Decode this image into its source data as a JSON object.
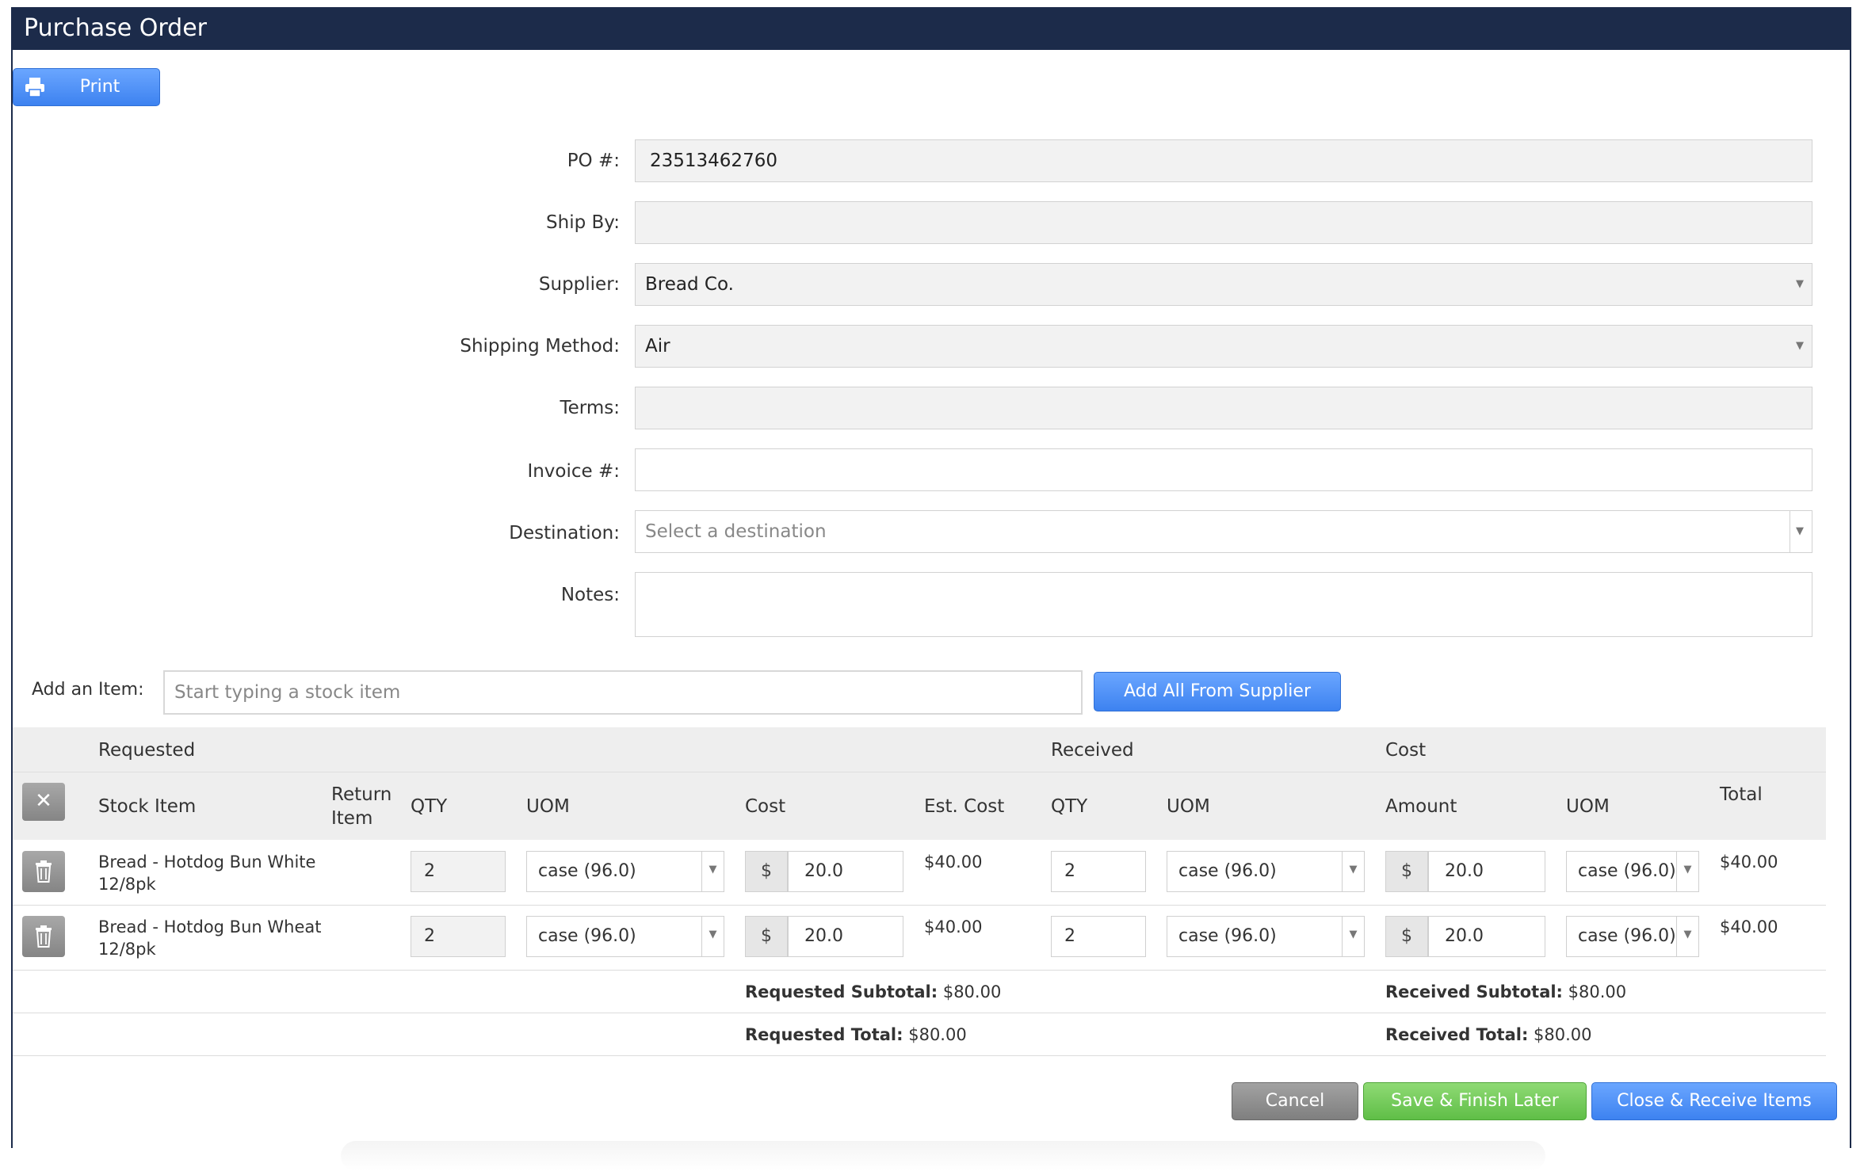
{
  "window": {
    "title": "Purchase Order"
  },
  "toolbar": {
    "print_label": "Print"
  },
  "form": {
    "po_label": "PO #:",
    "po_value": "23513462760",
    "ship_by_label": "Ship By:",
    "ship_by_value": "",
    "supplier_label": "Supplier:",
    "supplier_value": "Bread Co.",
    "shipping_method_label": "Shipping Method:",
    "shipping_method_value": "Air",
    "terms_label": "Terms:",
    "terms_value": "",
    "invoice_label": "Invoice #:",
    "invoice_value": "",
    "destination_label": "Destination:",
    "destination_placeholder": "Select a destination",
    "notes_label": "Notes:",
    "notes_value": ""
  },
  "add_item": {
    "label": "Add an Item:",
    "placeholder": "Start typing a stock item",
    "add_all_label": "Add All From Supplier"
  },
  "table": {
    "group_requested": "Requested",
    "group_received": "Received",
    "group_cost": "Cost",
    "col_stock_item": "Stock Item",
    "col_return_item": "Return Item",
    "col_req_qty": "QTY",
    "col_req_uom": "UOM",
    "col_req_cost": "Cost",
    "col_est_cost": "Est. Cost",
    "col_rec_qty": "QTY",
    "col_rec_uom": "UOM",
    "col_amount": "Amount",
    "col_cost_uom": "UOM",
    "col_total": "Total",
    "rows": [
      {
        "stock_item": "Bread - Hotdog Bun White 12/8pk",
        "req_qty": "2",
        "req_uom": "case (96.0)",
        "req_cost_symbol": "$",
        "req_cost": "20.0",
        "est_cost": "$40.00",
        "rec_qty": "2",
        "rec_uom": "case (96.0)",
        "amount_symbol": "$",
        "amount": "20.0",
        "cost_uom": "case (96.0)",
        "total": "$40.00"
      },
      {
        "stock_item": "Bread - Hotdog Bun Wheat 12/8pk",
        "req_qty": "2",
        "req_uom": "case (96.0)",
        "req_cost_symbol": "$",
        "req_cost": "20.0",
        "est_cost": "$40.00",
        "rec_qty": "2",
        "rec_uom": "case (96.0)",
        "amount_symbol": "$",
        "amount": "20.0",
        "cost_uom": "case (96.0)",
        "total": "$40.00"
      }
    ],
    "requested_subtotal_label": "Requested Subtotal:",
    "requested_subtotal": "$80.00",
    "received_subtotal_label": "Received Subtotal:",
    "received_subtotal": "$80.00",
    "requested_total_label": "Requested Total:",
    "requested_total": "$80.00",
    "received_total_label": "Received Total:",
    "received_total": "$80.00"
  },
  "footer": {
    "cancel_label": "Cancel",
    "save_label": "Save & Finish Later",
    "close_label": "Close & Receive Items"
  },
  "colors": {
    "titlebar": "#1c2b4a",
    "primary_button": "#3d82f0",
    "save_button": "#5fbe47",
    "cancel_button": "#7f7f7f"
  },
  "icons": [
    "printer-icon",
    "close-icon",
    "trash-icon",
    "chevron-down-icon"
  ]
}
